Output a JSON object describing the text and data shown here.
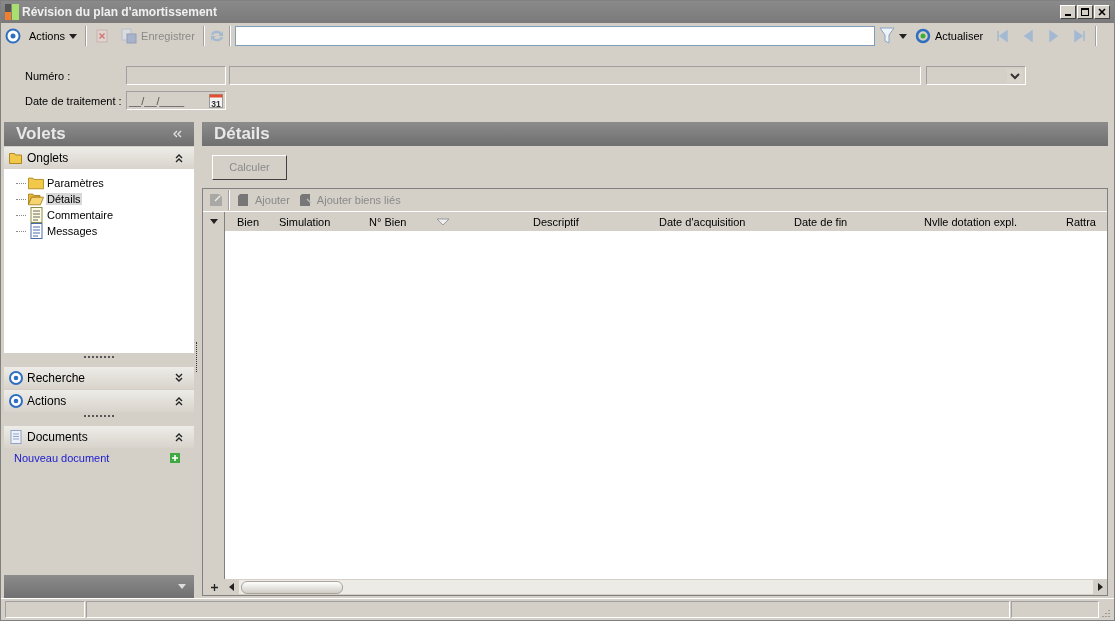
{
  "window": {
    "title": "Révision du plan d'amortissement"
  },
  "toolbar": {
    "actions": {
      "label": "Actions"
    },
    "delete": {
      "disabled": true
    },
    "save": {
      "label": "Enregistrer",
      "disabled": true
    },
    "refresh": {
      "label": "Actualiser"
    },
    "navigation": [
      {
        "kind": "first",
        "disabled": true
      },
      {
        "kind": "prev",
        "disabled": true
      },
      {
        "kind": "next",
        "disabled": true
      },
      {
        "kind": "last",
        "disabled": true
      }
    ]
  },
  "form": {
    "numero": {
      "label": "Numéro :"
    },
    "date": {
      "label": "Date de traitement :",
      "value": "__/__/____",
      "calendar_day": "31"
    }
  },
  "sidebar": {
    "title": "Volets",
    "sections": [
      {
        "kind": "tabs",
        "title": "Onglets",
        "expanded": true,
        "items": [
          {
            "label": "Paramètres",
            "kind": "folder",
            "selected": false
          },
          {
            "label": "Détails",
            "kind": "folder",
            "selected": true
          },
          {
            "label": "Commentaire",
            "kind": "note",
            "selected": false
          },
          {
            "label": "Messages",
            "kind": "document",
            "selected": false
          }
        ]
      },
      {
        "kind": "search",
        "title": "Recherche",
        "expanded": false
      },
      {
        "kind": "actions",
        "title": "Actions",
        "expanded": true
      },
      {
        "kind": "documents",
        "title": "Documents",
        "expanded": true,
        "link": "Nouveau document"
      }
    ]
  },
  "main": {
    "title": "Détails",
    "calculate": {
      "label": "Calculer",
      "disabled": true
    },
    "grid": {
      "toolbar": [
        {
          "label": "Ajouter",
          "disabled": true
        },
        {
          "label": "Ajouter biens liés",
          "disabled": true
        }
      ],
      "columns": [
        "Bien",
        "Simulation",
        "N° Bien",
        "Descriptif",
        "Date d'acquisition",
        "Date de fin",
        "Nvlle dotation expl.",
        "Rattra"
      ]
    }
  }
}
